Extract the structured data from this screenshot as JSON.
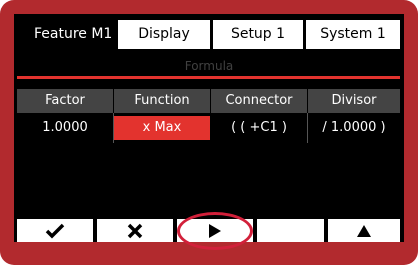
{
  "tabs": [
    {
      "label": "Feature  M1",
      "active": true
    },
    {
      "label": "Display",
      "active": false
    },
    {
      "label": "Setup 1",
      "active": false
    },
    {
      "label": "System 1",
      "active": false
    }
  ],
  "section_title": "Formula",
  "table": {
    "headers": [
      "Factor",
      "Function",
      "Connector",
      "Divisor"
    ],
    "values": [
      "1.0000",
      "x Max",
      "( ( +C1 )",
      "/ 1.0000 )"
    ],
    "selected_column": 1
  },
  "softkeys": [
    {
      "icon": "checkmark-icon"
    },
    {
      "icon": "x-icon"
    },
    {
      "icon": "play-right-icon"
    },
    {
      "icon": ""
    },
    {
      "icon": "triangle-up-icon"
    }
  ],
  "colors": {
    "frame": "#b22a2e",
    "accent": "#e3332e",
    "highlight_ring": "#d2203a",
    "header_bg": "#444444"
  }
}
